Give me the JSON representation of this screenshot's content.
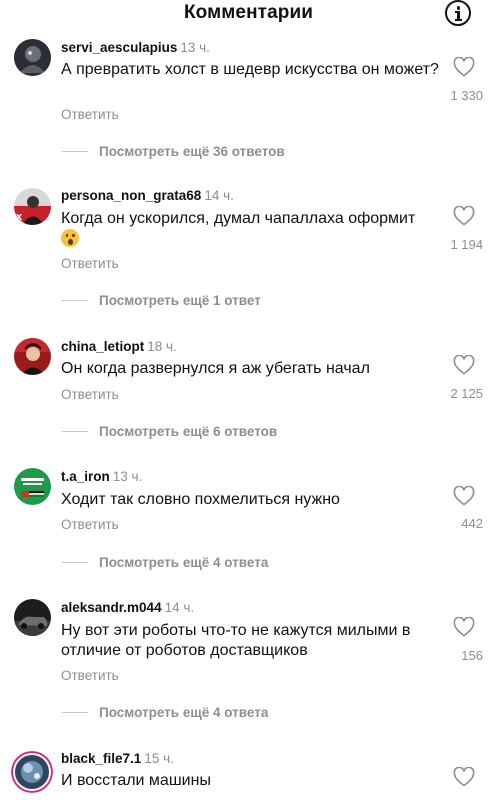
{
  "header": {
    "title": "Комментарии"
  },
  "comments": [
    {
      "username": "servi_aesculapius",
      "time": "13 ч.",
      "text": "А превратить холст в шедевр искусства он может?",
      "reply": "Ответить",
      "likes": "1 330",
      "view_replies": "Посмотреть ещё 36 ответов"
    },
    {
      "username": "persona_non_grata68",
      "time": "14 ч.",
      "text": "Когда он ускорился, думал чапаллаха оформит",
      "emoji": "astonished-face-emoji",
      "reply": "Ответить",
      "likes": "1 194",
      "view_replies": "Посмотреть ещё 1 ответ"
    },
    {
      "username": "china_letiopt",
      "time": "18 ч.",
      "text": "Он когда развернулся я аж убегать начал",
      "reply": "Ответить",
      "likes": "2 125",
      "view_replies": "Посмотреть ещё 6 ответов"
    },
    {
      "username": "t.a_iron",
      "time": "13 ч.",
      "text": "Ходит так словно похмелиться нужно",
      "reply": "Ответить",
      "likes": "442",
      "view_replies": "Посмотреть ещё 4 ответа"
    },
    {
      "username": "aleksandr.m044",
      "time": "14 ч.",
      "text": "Ну вот эти роботы что-то не кажутся милыми в отличие от роботов доставщиков",
      "reply": "Ответить",
      "likes": "156",
      "view_replies": "Посмотреть ещё 4 ответа"
    },
    {
      "username": "black_file7.1",
      "time": "15 ч.",
      "text": "И восстали машины"
    }
  ],
  "icons": {
    "header": "info-icon",
    "like": "heart-icon"
  },
  "colors": {
    "text": "#111111",
    "secondary": "#8e8e8e",
    "story_ring": "#d62976",
    "avatar_green": "#1e9a48"
  }
}
